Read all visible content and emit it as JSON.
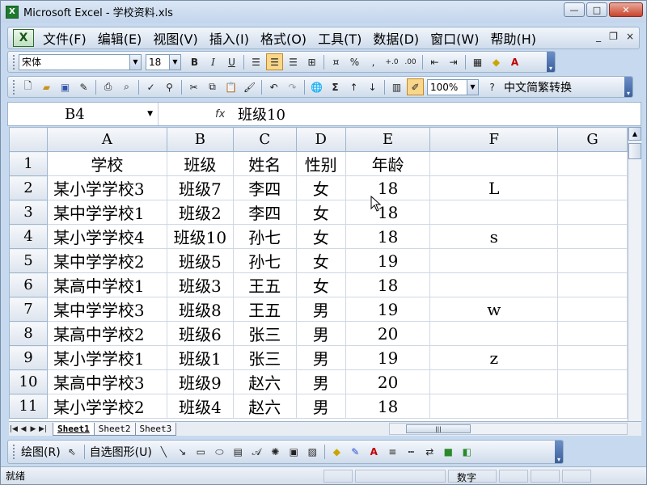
{
  "window": {
    "title": "Microsoft Excel - 学校资料.xls",
    "app_icon": "excel-icon"
  },
  "window_controls": {
    "minimize": "—",
    "restore": "□",
    "close": "✕"
  },
  "menubar": {
    "items": [
      "文件(F)",
      "编辑(E)",
      "视图(V)",
      "插入(I)",
      "格式(O)",
      "工具(T)",
      "数据(D)",
      "窗口(W)",
      "帮助(H)"
    ],
    "doc_controls": {
      "minimize": "_",
      "restore": "❐",
      "close": "×"
    }
  },
  "format_toolbar": {
    "font": "宋体",
    "size": "18",
    "bold": "B",
    "italic": "I",
    "underline": "U",
    "percent": "%",
    "comma": ",",
    "inc_decimal": "+.0",
    "dec_decimal": ".00"
  },
  "standard_toolbar": {
    "zoom": "100%",
    "sum": "Σ",
    "chinese_convert": "中文简繁转换"
  },
  "formula_bar": {
    "name_box": "B4",
    "fx": "fx",
    "content": "班级10"
  },
  "sheet": {
    "columns": [
      "A",
      "B",
      "C",
      "D",
      "E",
      "F",
      "G"
    ],
    "rows": [
      {
        "num": "1",
        "cells": [
          "学校",
          "班级",
          "姓名",
          "性别",
          "年龄",
          "",
          ""
        ]
      },
      {
        "num": "2",
        "cells": [
          "某小学学校3",
          "班级7",
          "李四",
          "女",
          "18",
          "L",
          ""
        ]
      },
      {
        "num": "3",
        "cells": [
          "某中学学校1",
          "班级2",
          "李四",
          "女",
          "18",
          "",
          ""
        ]
      },
      {
        "num": "4",
        "cells": [
          "某小学学校4",
          "班级10",
          "孙七",
          "女",
          "18",
          "s",
          ""
        ]
      },
      {
        "num": "5",
        "cells": [
          "某中学学校2",
          "班级5",
          "孙七",
          "女",
          "19",
          "",
          ""
        ]
      },
      {
        "num": "6",
        "cells": [
          "某高中学校1",
          "班级3",
          "王五",
          "女",
          "18",
          "",
          ""
        ]
      },
      {
        "num": "7",
        "cells": [
          "某中学学校3",
          "班级8",
          "王五",
          "男",
          "19",
          "w",
          ""
        ]
      },
      {
        "num": "8",
        "cells": [
          "某高中学校2",
          "班级6",
          "张三",
          "男",
          "20",
          "",
          ""
        ]
      },
      {
        "num": "9",
        "cells": [
          "某小学学校1",
          "班级1",
          "张三",
          "男",
          "19",
          "z",
          ""
        ]
      },
      {
        "num": "10",
        "cells": [
          "某高中学校3",
          "班级9",
          "赵六",
          "男",
          "20",
          "",
          ""
        ]
      },
      {
        "num": "11",
        "cells": [
          "某小学学校2",
          "班级4",
          "赵六",
          "男",
          "18",
          "",
          ""
        ]
      }
    ]
  },
  "sheet_tabs": [
    "Sheet1",
    "Sheet2",
    "Sheet3"
  ],
  "drawing_toolbar": {
    "draw": "绘图(R)",
    "autoshapes": "自选图形(U)"
  },
  "status_bar": {
    "left": "就绪",
    "mode": "数字"
  }
}
